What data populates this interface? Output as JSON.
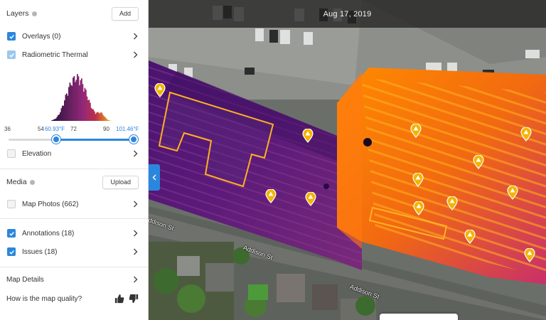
{
  "sidebar": {
    "layers": {
      "title": "Layers",
      "add_label": "Add",
      "items": [
        {
          "label": "Overlays (0)",
          "state": "checked"
        },
        {
          "label": "Radiometric Thermal",
          "state": "checked-light"
        }
      ],
      "elevation": {
        "label": "Elevation",
        "state": "unchecked"
      }
    },
    "thermal_histogram": {
      "ticks": [
        "36",
        "54",
        "72",
        "90"
      ],
      "range_min_label": "60.93°F",
      "range_max_label": "101.46°F",
      "axis_min": 36,
      "axis_max": 104,
      "range_min": 60.93,
      "range_max": 101.46,
      "accent_color": "#2b86de"
    },
    "media": {
      "title": "Media",
      "upload_label": "Upload",
      "items": [
        {
          "label": "Map Photos (662)",
          "state": "unchecked"
        },
        {
          "label": "Annotations (18)",
          "state": "checked"
        },
        {
          "label": "Issues (18)",
          "state": "checked"
        }
      ]
    },
    "map_details": {
      "label": "Map Details"
    },
    "quality": {
      "question": "How is the map quality?",
      "up_icon": "thumbs-up-icon",
      "down_icon": "thumbs-down-icon"
    }
  },
  "map": {
    "date": "Aug 17, 2019",
    "streets": [
      "Addison St",
      "Addison St",
      "Addison St"
    ],
    "pin_color": "#f4b400"
  }
}
